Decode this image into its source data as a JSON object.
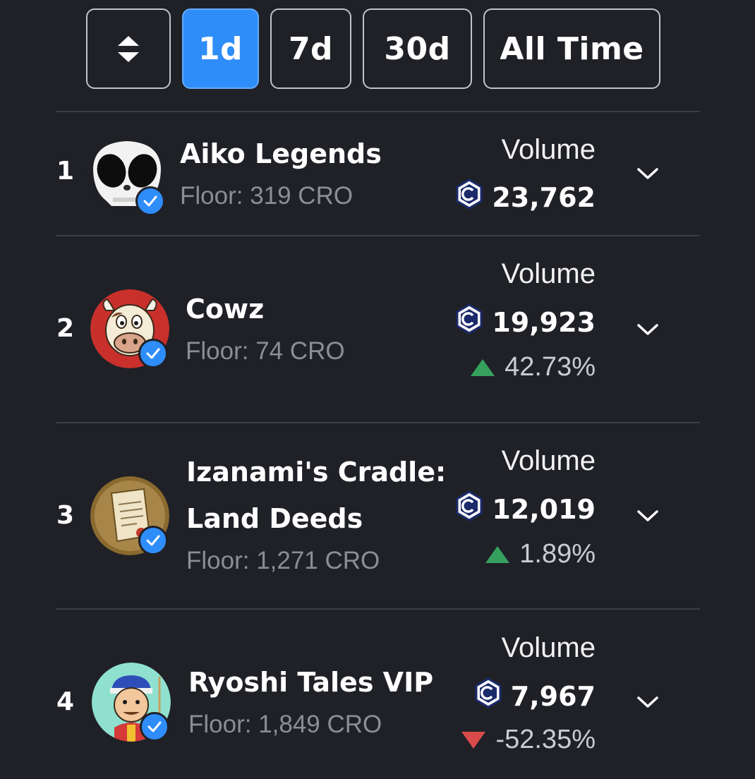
{
  "filters": {
    "sort_icon": "sort-updown-icon",
    "buttons": [
      "1d",
      "7d",
      "30d",
      "All Time"
    ],
    "active": "1d",
    "active_color": "#2f8dfa"
  },
  "collections": [
    {
      "rank": "1",
      "name": "Aiko Legends",
      "name_line2": "",
      "floor": "Floor: 319 CRO",
      "volume_label": "Volume",
      "volume": "23,762",
      "change": "",
      "direction": ""
    },
    {
      "rank": "2",
      "name": "Cowz",
      "name_line2": "",
      "floor": "Floor: 74 CRO",
      "volume_label": "Volume",
      "volume": "19,923",
      "change": "42.73%",
      "direction": "up"
    },
    {
      "rank": "3",
      "name": "Izanami's Cradle:",
      "name_line2": "Land Deeds",
      "floor": "Floor: 1,271 CRO",
      "volume_label": "Volume",
      "volume": "12,019",
      "change": "1.89%",
      "direction": "up"
    },
    {
      "rank": "4",
      "name": "Ryoshi Tales VIP",
      "name_line2": "",
      "floor": "Floor: 1,849 CRO",
      "volume_label": "Volume",
      "volume": "7,967",
      "change": "-52.35%",
      "direction": "down"
    }
  ],
  "colors": {
    "background": "#1f2127",
    "up": "#36a15e",
    "down": "#d94a4a",
    "verified": "#2f8dfa"
  }
}
